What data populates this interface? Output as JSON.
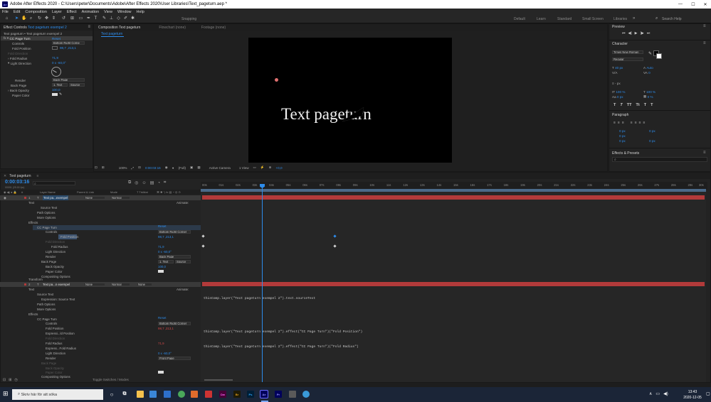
{
  "title_bar": {
    "text": "Adobe After Effects 2020 - C:\\Users\\peter\\Documents\\Adobe\\After Effects 2020\\User Libraries\\Text_pageturn.aep *",
    "logo": "Ae"
  },
  "menu": [
    "File",
    "Edit",
    "Composition",
    "Layer",
    "Effect",
    "Animation",
    "View",
    "Window",
    "Help"
  ],
  "toolbar": {
    "snapping": "Snapping",
    "workspaces": [
      "Default",
      "Learn",
      "Standard",
      "Small Screen",
      "Libraries"
    ],
    "search_placeholder": "Search Help"
  },
  "effect_controls": {
    "tab": "Effect Controls Text pageturn exempel 2",
    "tab_prefix": "Effect Controls",
    "tab_layer": "Text pageturn exempel 2",
    "breadcrumb": "Text pageturn • Text pageturn exempel 2",
    "effect_name": "CC Page Turn",
    "reset": "Reset",
    "controls": "Controls",
    "controls_value": "Bottom Right Corne",
    "fold_position": "Fold Position",
    "fold_position_value": "98,7 ,213,1",
    "fold_direction": "Fold Direction",
    "fold_radius": "Fold Radius",
    "fold_radius_value": "71,9",
    "light_direction": "Light Direction",
    "light_direction_value": "0 x -60,0°",
    "render": "Render",
    "render_value": "Back Page",
    "back_page": "Back Page",
    "back_page_layer": "1. Text",
    "back_page_source": "Source",
    "back_opacity": "Back Opacity",
    "back_opacity_value": "100,0",
    "paper_color": "Paper Color"
  },
  "composition": {
    "tab": "Composition Text pageturn",
    "flowchart": "Flowchart (none)",
    "footage": "Footage (none)",
    "subtab": "Text pageturn",
    "text": "Text pageturn",
    "zoom": "100%",
    "timecode": "0:00:03:16",
    "resolution": "(Full)",
    "camera": "Active Camera",
    "view": "1 View",
    "exposure": "+0,0"
  },
  "right_panel": {
    "preview": "Preview",
    "character": "Character",
    "font": "Times New Roman",
    "style": "Regular",
    "font_size": "40 px",
    "leading": "Auto",
    "tracking": "0",
    "stroke": "- px",
    "vscale": "100 %",
    "hscale": "100 %",
    "baseline": "0 px",
    "tsume": "0 %",
    "format_buttons": [
      "T",
      "T",
      "TT",
      "Tt",
      "T",
      "T"
    ],
    "paragraph": "Paragraph",
    "para_vals": [
      "0 px",
      "0 px",
      "0 px",
      "0 px",
      "0 px"
    ],
    "effects_presets": "Effects & Presets"
  },
  "timeline": {
    "tab": "Text pageturn",
    "timecode": "0:00:03:16",
    "frames": "00091 (25.00 fps)",
    "columns": [
      "Layer Name",
      "Parent & Link",
      "Mode",
      "T TrkMat"
    ],
    "ruler": [
      "00s",
      "01s",
      "02s",
      "03s",
      "04s",
      "05s",
      "06s",
      "07s",
      "08s",
      "09s",
      "10s",
      "11s",
      "12s",
      "13s",
      "14s",
      "15s",
      "16s",
      "17s",
      "18s",
      "19s",
      "20s",
      "21s",
      "22s",
      "23s",
      "24s",
      "25s",
      "26s",
      "27s",
      "28s",
      "29s",
      "30s"
    ],
    "layer1": {
      "num": "1",
      "name": "Text pa...exempel",
      "parent": "None",
      "mode": "Normal"
    },
    "layer2": {
      "num": "2",
      "name": "Text pa...n exempel",
      "parent": "None",
      "mode": "Normal",
      "trkmat": "None"
    },
    "animate": "Animate:",
    "props1": {
      "text": "Text",
      "source_text": "Source Text",
      "path_options": "Path Options",
      "more_options": "More Options",
      "effects": "Effects",
      "cc_page_turn": "CC Page Turn",
      "reset": "Reset",
      "controls": "Controls",
      "controls_val": "Bottom Right Corner",
      "fold_position": "Fold Position",
      "fold_position_val": "98,7 ,213,1",
      "fold_direction": "Fold Direction",
      "fold_radius": "Fold Radius",
      "fold_radius_val": "71,9",
      "light_direction": "Light Direction",
      "light_direction_val": "0 x -60,0°",
      "render": "Render",
      "render_val": "Back Page",
      "back_page": "Back Page",
      "back_page_val": "1. Text",
      "back_page_src": "Source",
      "back_opacity": "Back Opacity",
      "back_opacity_val": "100,0",
      "paper_color": "Paper Color",
      "compositing": "Compositing Options",
      "transform": "Transform"
    },
    "props2": {
      "text": "Text",
      "source_text": "Source Text",
      "expr_source": "Expression: Source Text",
      "path_options": "Path Options",
      "more_options": "More Options",
      "effects": "Effects",
      "cc_page_turn": "CC Page Turn",
      "reset": "Reset",
      "controls": "Controls",
      "controls_val": "Bottom Right Corner",
      "fold_position": "Fold Position",
      "fold_position_val": "98,7 ,213,1",
      "expr_fold_pos": "Expressi...ld Position",
      "fold_direction": "Fold Direction",
      "fold_radius": "Fold Radius",
      "fold_radius_val": "71,9",
      "expr_fold_rad": "Express...Fold Radius",
      "light_direction": "Light Direction",
      "light_direction_val": "0 x -60,0°",
      "render": "Render",
      "render_val": "Front Page",
      "back_page": "Back Page",
      "back_opacity": "Back Opacity",
      "paper_color": "Paper Color",
      "compositing": "Compositing Options"
    },
    "expressions": [
      "thisComp.layer(\"Text pageturn exempel 2\").text.sourceText",
      "thisComp.layer(\"Text pageturn exempel 2\").effect(\"CC Page Turn\")(\"Fold Position\")",
      "thisComp.layer(\"Text pageturn exempel 2\").effect(\"CC Page Turn\")(\"Fold Radius\")"
    ],
    "footer": "Toggle Switches / Modes"
  },
  "taskbar": {
    "search_placeholder": "Skriv här för att söka",
    "time": "13:43",
    "date": "2020-12-05",
    "apps": [
      "Dw",
      "Br",
      "Ps",
      "Ae",
      "Pr"
    ]
  },
  "colors": {
    "accent": "#2d8ceb",
    "layer_bar": "#b23a3a",
    "playhead": "#2d8ceb"
  }
}
